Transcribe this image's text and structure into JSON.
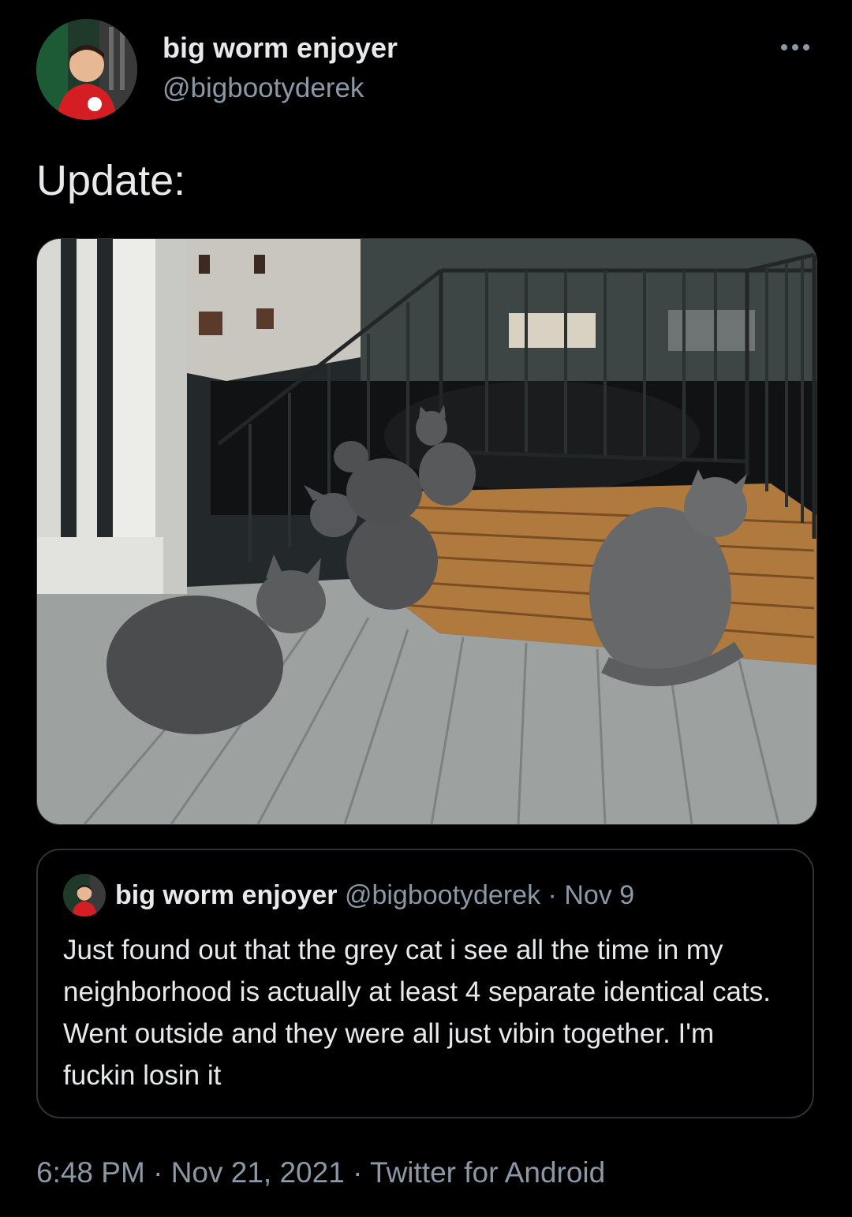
{
  "tweet": {
    "author_name": "big worm enjoyer",
    "author_handle": "@bigbootyderek",
    "text": "Update:",
    "timestamp": "6:48 PM",
    "date": "Nov 21, 2021",
    "client": "Twitter for Android",
    "separator": "·"
  },
  "quoted_tweet": {
    "author_name": "big worm enjoyer",
    "author_handle": "@bigbootyderek",
    "separator": "·",
    "date": "Nov 9",
    "text": "Just found out that the grey cat i see all the time in my neighborhood is actually at least 4 separate identical cats. Went outside and they were all just vibin together. I'm fuckin losin it"
  },
  "icons": {
    "more": "more-options-icon"
  },
  "colors": {
    "background": "#000000",
    "primary_text": "#e7e9ea",
    "secondary_text": "#8b98a5",
    "border": "#2f3336"
  }
}
